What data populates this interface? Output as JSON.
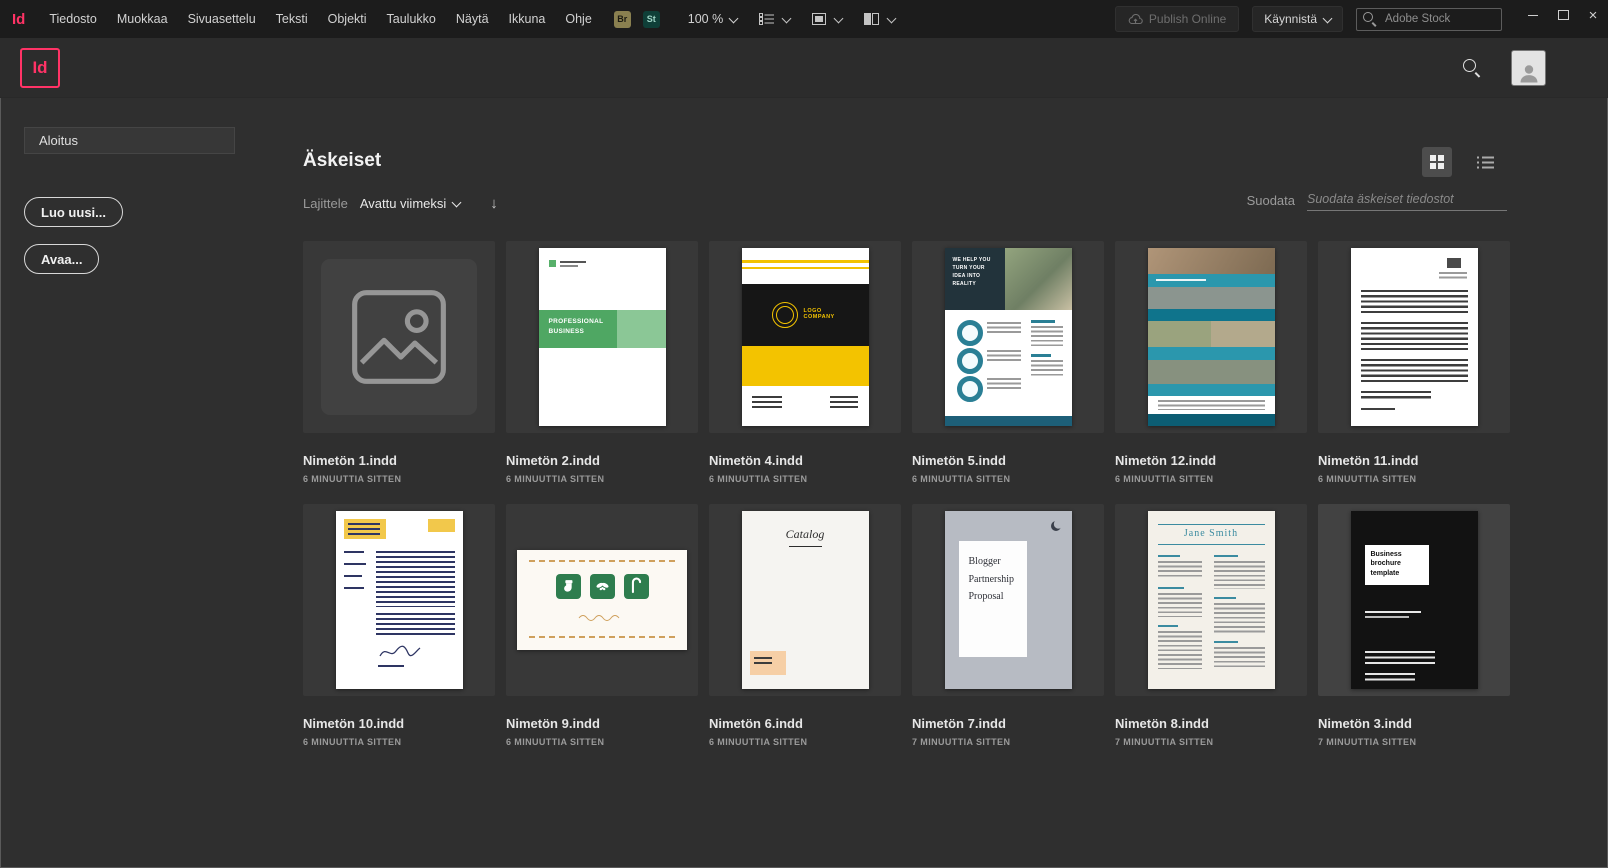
{
  "menubar": {
    "logo": "Id",
    "items": [
      "Tiedosto",
      "Muokkaa",
      "Sivuasettelu",
      "Teksti",
      "Objekti",
      "Taulukko",
      "Näytä",
      "Ikkuna",
      "Ohje"
    ],
    "bridge_badge": "Br",
    "stock_badge": "St",
    "zoom_level": "100 %",
    "publish_online_label": "Publish Online",
    "launch_label": "Käynnistä",
    "stock_search_placeholder": "Adobe Stock"
  },
  "appbar": {
    "logo": "Id"
  },
  "sidebar": {
    "home_label": "Aloitus",
    "create_button_label": "Luo uusi...",
    "open_button_label": "Avaa..."
  },
  "main": {
    "title": "Äskeiset",
    "sort_label": "Lajittele",
    "sort_value": "Avattu viimeksi",
    "filter_label": "Suodata",
    "filter_placeholder": "Suodata äskeiset tiedostot"
  },
  "icons": {
    "close_glyph": "×",
    "sort_direction_glyph": "↓"
  },
  "colors": {
    "accent": "#ff3366",
    "topbar_bg": "#1c1c1c",
    "content_bg": "#2f2f2f"
  },
  "cards": [
    {
      "name": "Nimetön 1.indd",
      "time": "6 MINUUTTIA SITTEN"
    },
    {
      "name": "Nimetön 2.indd",
      "time": "6 MINUUTTIA SITTEN",
      "thumb_text": "PROFESSIONAL BUSINESS"
    },
    {
      "name": "Nimetön 4.indd",
      "time": "6 MINUUTTIA SITTEN",
      "thumb_text": "LOGO COMPANY"
    },
    {
      "name": "Nimetön 5.indd",
      "time": "6 MINUUTTIA SITTEN",
      "thumb_text": "WE HELP YOU TURN YOUR IDEA INTO REALITY"
    },
    {
      "name": "Nimetön 12.indd",
      "time": "6 MINUUTTIA SITTEN"
    },
    {
      "name": "Nimetön 11.indd",
      "time": "6 MINUUTTIA SITTEN"
    },
    {
      "name": "Nimetön 10.indd",
      "time": "6 MINUUTTIA SITTEN"
    },
    {
      "name": "Nimetön 9.indd",
      "time": "6 MINUUTTIA SITTEN"
    },
    {
      "name": "Nimetön 6.indd",
      "time": "6 MINUUTTIA SITTEN",
      "thumb_text": "Catalog"
    },
    {
      "name": "Nimetön 7.indd",
      "time": "7 MINUUTTIA SITTEN",
      "thumb_text": "Blogger Partnership Proposal"
    },
    {
      "name": "Nimetön 8.indd",
      "time": "7 MINUUTTIA SITTEN",
      "thumb_text": "Jane Smith"
    },
    {
      "name": "Nimetön 3.indd",
      "time": "7 MINUUTTIA SITTEN",
      "thumb_text": "Business brochure template"
    }
  ]
}
